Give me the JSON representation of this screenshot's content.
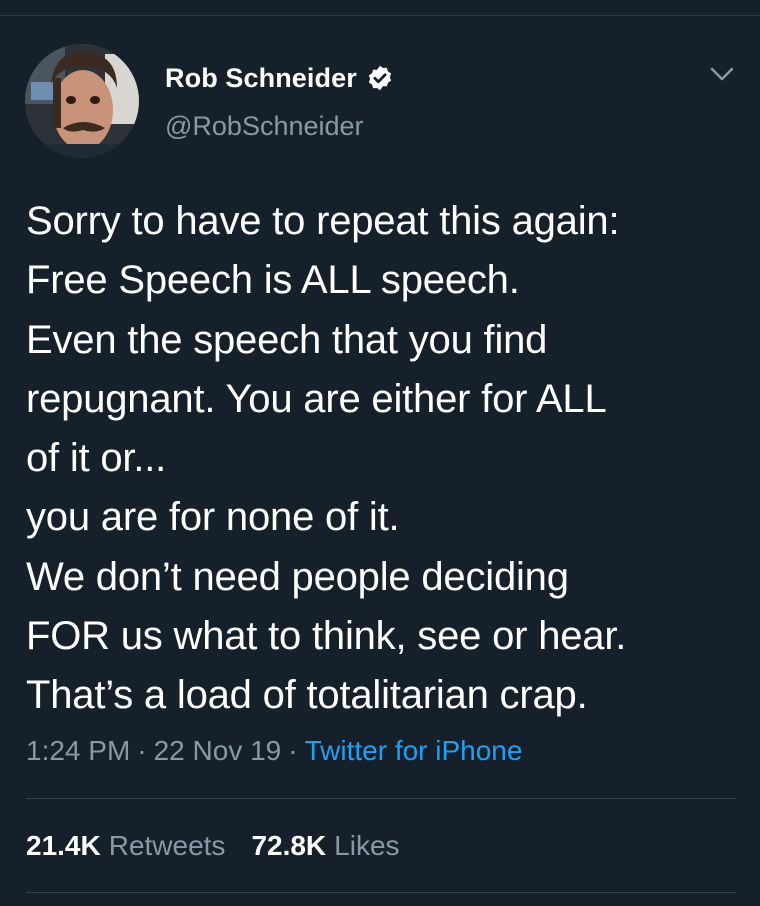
{
  "user": {
    "display_name": "Rob Schneider",
    "handle": "@RobSchneider",
    "verified": true
  },
  "tweet": {
    "text": "Sorry to have to repeat this again:\nFree Speech is ALL speech.\nEven the speech that you find\nrepugnant. You are either for ALL\nof it or...\nyou are for none of it.\nWe don’t need people deciding\nFOR us what to think, see or hear.\nThat’s a load of totalitarian crap.",
    "time": "1:24 PM",
    "separator": "·",
    "date": "22 Nov 19",
    "source": "Twitter for iPhone"
  },
  "stats": {
    "retweets_count": "21.4K",
    "retweets_label": "Retweets",
    "likes_count": "72.8K",
    "likes_label": "Likes"
  },
  "colors": {
    "background": "#15202b",
    "secondary_text": "#8899a6",
    "accent": "#1da1f2"
  },
  "icons": {
    "verified": "verified-badge-icon",
    "more": "chevron-down-icon"
  }
}
